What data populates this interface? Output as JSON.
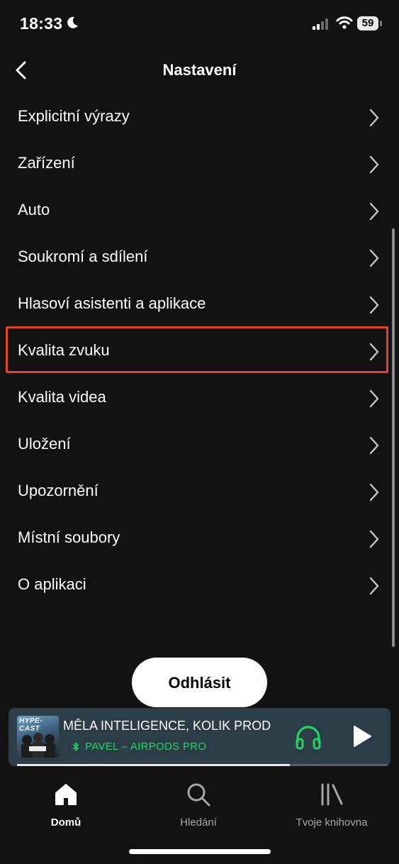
{
  "status_bar": {
    "time": "18:33",
    "battery": "59"
  },
  "header": {
    "title": "Nastavení"
  },
  "settings": {
    "items": [
      {
        "label": "Explicitní výrazy"
      },
      {
        "label": "Zařízení"
      },
      {
        "label": "Auto"
      },
      {
        "label": "Soukromí a sdílení"
      },
      {
        "label": "Hlasoví asistenti a aplikace"
      },
      {
        "label": "Kvalita zvuku",
        "highlighted": true
      },
      {
        "label": "Kvalita videa"
      },
      {
        "label": "Uložení"
      },
      {
        "label": "Upozornění"
      },
      {
        "label": "Místní soubory"
      },
      {
        "label": "O aplikaci"
      }
    ]
  },
  "logout": {
    "label": "Odhlásit"
  },
  "mini_player": {
    "title": "MĚLA INTELIGENCE, KOLIK PROD",
    "cover_text": "HYPE-CAST",
    "device": "PAVEL – AIRPODS PRO",
    "progress": 0.73
  },
  "tabs": [
    {
      "label": "Domů",
      "active": true,
      "icon": "home-icon"
    },
    {
      "label": "Hledání",
      "active": false,
      "icon": "search-icon"
    },
    {
      "label": "Tvoje knihovna",
      "active": false,
      "icon": "library-icon"
    }
  ],
  "colors": {
    "background": "#121212",
    "accent_green": "#1ed760",
    "highlight_box": "#e0442a",
    "mini_player_bg": "#2d3d48"
  }
}
